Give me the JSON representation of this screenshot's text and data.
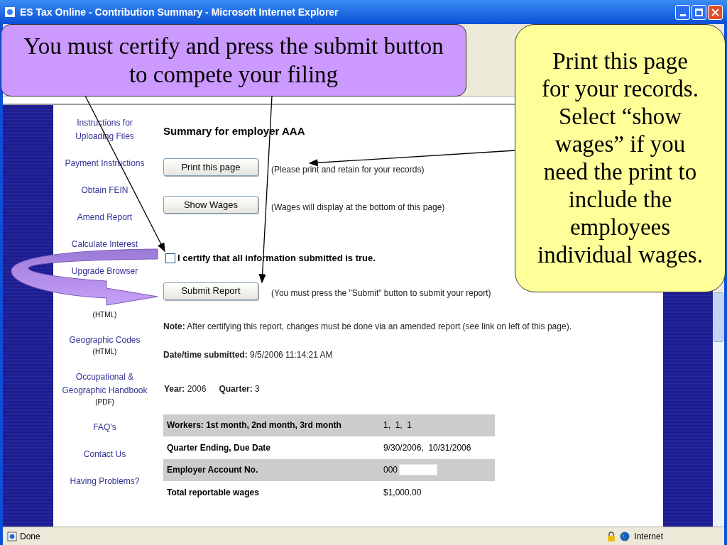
{
  "window": {
    "title": "ES Tax Online - Contribution Summary - Microsoft Internet Explorer"
  },
  "sidebar": {
    "items": [
      {
        "label": "Instructions for Uploading Files"
      },
      {
        "label": "Payment Instructions"
      },
      {
        "label": "Obtain FEIN"
      },
      {
        "label": "Amend Report"
      },
      {
        "label": "Calculate Interest"
      },
      {
        "label": "Upgrade Browser"
      },
      {
        "sub": "(HTML)"
      },
      {
        "label": "Geographic Codes",
        "sub": "(HTML)"
      },
      {
        "label": "Occupational & Geographic Handbook",
        "sub": "(PDF)"
      },
      {
        "label": "FAQ's"
      },
      {
        "label": "Contact Us"
      },
      {
        "label": "Having Problems?"
      }
    ]
  },
  "main": {
    "heading": "Summary for employer AAA",
    "actions": [
      {
        "button": "Print this page",
        "note": "(Please print and retain for your records)"
      },
      {
        "button": "Show Wages",
        "note": "(Wages will display at the bottom of this page)"
      }
    ],
    "certify": {
      "label": "I certify that all information submitted is true.",
      "checked": false
    },
    "submit": {
      "button": "Submit Report",
      "note": "(You must press the \"Submit\" button to submit your report)"
    },
    "note": "**Note:** After certifying this report, changes must be done via an amended report (see link on left of this page).",
    "submitted": "**Date/time submitted:** 9/5/2006 11:14:21 AM",
    "year": {
      "label": "Year:",
      "value": "2006"
    },
    "quarter": {
      "label": "Quarter:",
      "value": "3"
    },
    "table": {
      "rows": [
        {
          "label": "Workers: 1st month, 2nd month, 3rd month",
          "value": "1,  1,  1",
          "redacted": false
        },
        {
          "label": "Quarter Ending, Due Date",
          "value": "9/30/2006,  10/31/2006",
          "redacted": false
        },
        {
          "label": "Employer Account No.",
          "value": "000",
          "redacted": true
        },
        {
          "label": "Total reportable wages",
          "value": "$1,000.00",
          "redacted": false
        }
      ]
    }
  },
  "status_bar": {
    "text": "Done",
    "zone": "Internet"
  },
  "callouts": [
    {
      "text": "You must certify and press the submit button to compete your filing",
      "color": "#cc99ff"
    },
    {
      "text": "Print this page for your records. Select “show wages” if you need the print to include the employees individual wages.",
      "color": "#ffff99"
    }
  ]
}
